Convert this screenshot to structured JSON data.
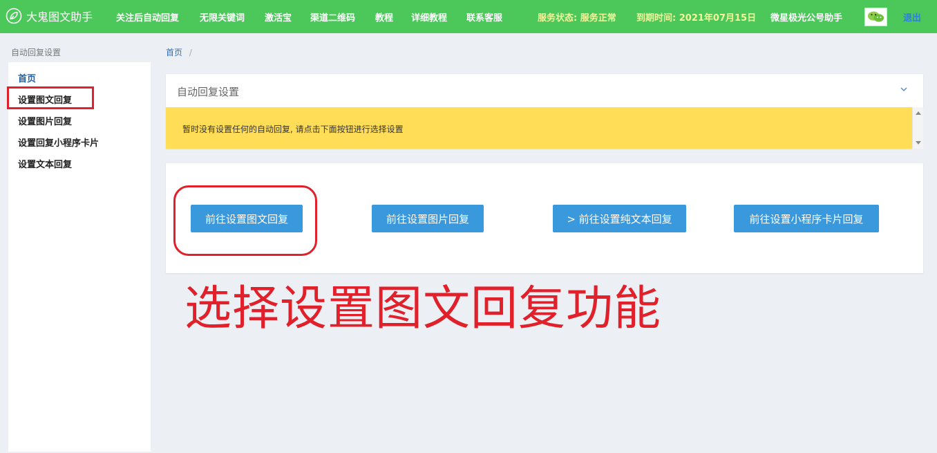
{
  "app": {
    "title": "大鬼图文助手"
  },
  "nav": {
    "items": [
      "关注后自动回复",
      "无限关键词",
      "激活宝",
      "渠道二维码",
      "教程",
      "详细教程",
      "联系客服"
    ]
  },
  "header": {
    "service_status": "服务状态: 服务正常",
    "expiry": "到期时间: 2021年07月15日",
    "account_name": "微星极光公号助手",
    "logout_label": "退出"
  },
  "sidebar": {
    "title": "自动回复设置",
    "items": [
      {
        "label": "首页"
      },
      {
        "label": "设置图文回复"
      },
      {
        "label": "设置图片回复"
      },
      {
        "label": "设置回复小程序卡片"
      },
      {
        "label": "设置文本回复"
      }
    ]
  },
  "breadcrumb": {
    "home": "首页",
    "separator": "/"
  },
  "panel": {
    "title": "自动回复设置",
    "alert_text": "暂时没有设置任何的自动回复, 请点击下面按钮进行选择设置"
  },
  "buttons": {
    "image_text": "前往设置图文回复",
    "image": "前往设置图片回复",
    "plain_text": "> 前往设置纯文本回复",
    "mini_program": "前往设置小程序卡片回复"
  },
  "annotation": {
    "text": "选择设置图文回复功能"
  },
  "colors": {
    "topbar": "#4cc75a",
    "status_text": "#f2f79a",
    "logout": "#2e7de0",
    "button": "#3a98dc",
    "alert": "#ffdd57",
    "highlight": "#e0202a"
  }
}
